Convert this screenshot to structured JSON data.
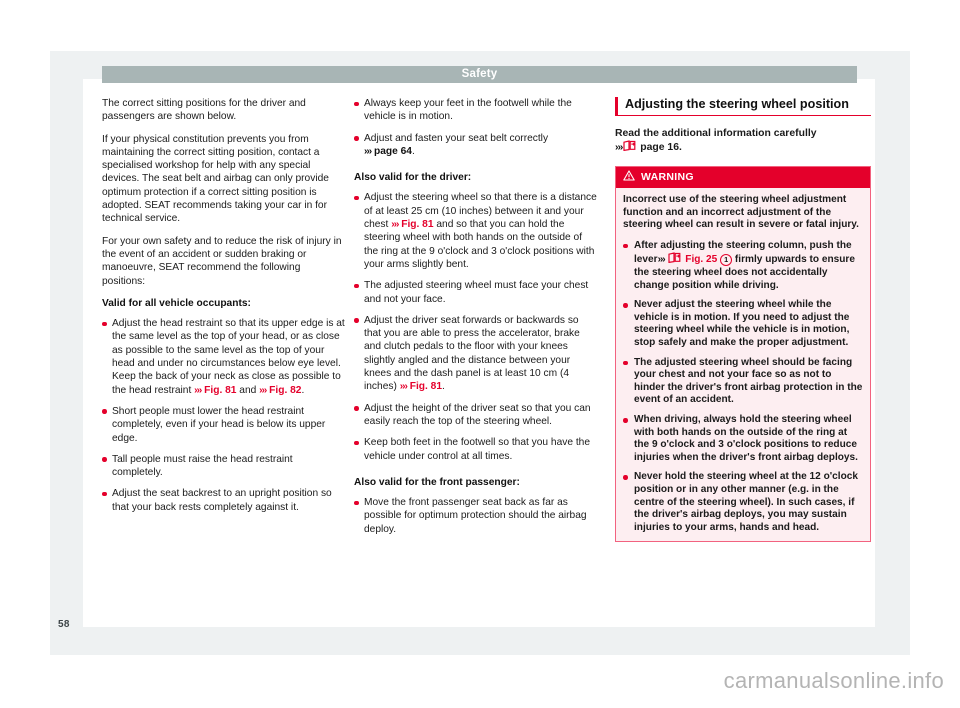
{
  "header": {
    "title": "Safety"
  },
  "folio": {
    "page_number": "58"
  },
  "watermark": {
    "text": "carmanualsonline.info"
  },
  "column1": {
    "p1": "The correct sitting positions for the driver and passengers are shown below.",
    "p2": "If your physical constitution prevents you from maintaining the correct sitting position, contact a specialised workshop for help with any special devices. The seat belt and airbag can only provide optimum protection if a correct sitting position is adopted. SEAT recommends taking your car in for technical service.",
    "p3": "For your own safety and to reduce the risk of injury in the event of an accident or sudden braking or manoeuvre, SEAT recommend the following positions:",
    "subhead": "Valid for all vehicle occupants:",
    "b1_a": "Adjust the head restraint so that its upper edge is at the same level as the top of your head, or as close as possible to the same level as the top of your head and under no circumstances below eye level. Keep the back of your neck as close as possible to the head restraint",
    "b1_ref1": "Fig. 81",
    "b1_mid": "and",
    "b1_ref2": "Fig. 82",
    "b1_end": ".",
    "b2": "Short people must lower the head restraint completely, even if your head is below its upper edge.",
    "b3": "Tall people must raise the head restraint completely.",
    "b4": "Adjust the seat backrest to an upright position so that your back rests completely against it."
  },
  "column2": {
    "b1": "Always keep your feet in the footwell while the vehicle is in motion.",
    "b2_a": "Adjust and fasten your seat belt correctly",
    "b2_ref": "page 64",
    "b2_end": ".",
    "subhead_driver": "Also valid for the driver:",
    "b3_a": "Adjust the steering wheel so that there is a distance of at least 25 cm (10 inches) between it and your chest",
    "b3_ref": "Fig. 81",
    "b3_b": "and so that you can hold the steering wheel with both hands on the outside of the ring at the 9 o'clock and 3 o'clock positions with your arms slightly bent.",
    "b4": "The adjusted steering wheel must face your chest and not your face.",
    "b5_a": "Adjust the driver seat forwards or backwards so that you are able to press the accelerator, brake and clutch pedals to the floor with your knees slightly angled and the distance between your knees and the dash panel is at least 10 cm (4 inches)",
    "b5_ref": "Fig. 81",
    "b5_end": ".",
    "b6": "Adjust the height of the driver seat so that you can easily reach the top of the steering wheel.",
    "b7": "Keep both feet in the footwell so that you have the vehicle under control at all times.",
    "subhead_passenger": "Also valid for the front passenger:",
    "b8": "Move the front passenger seat back as far as possible for optimum protection should the airbag deploy."
  },
  "column3": {
    "heading": "Adjusting the steering wheel position",
    "intro_line1": "Read the additional information carefully",
    "intro_page": "page 16",
    "intro_end": ".",
    "warning": {
      "label": "WARNING",
      "lead": "Incorrect use of the steering wheel adjustment function and an incorrect adjustment of the steering wheel can result in severe or fatal injury.",
      "b1_a": "After adjusting the steering column, push the lever",
      "b1_ref": "Fig. 25",
      "b1_circled": "1",
      "b1_b": "firmly upwards to ensure the steering wheel does not accidentally change position while driving.",
      "b2": "Never adjust the steering wheel while the vehicle is in motion. If you need to adjust the steering wheel while the vehicle is in motion, stop safely and make the proper adjustment.",
      "b3": "The adjusted steering wheel should be facing your chest and not your face so as not to hinder the driver's front airbag protection in the event of an accident.",
      "b4": "When driving, always hold the steering wheel with both hands on the outside of the ring at the 9 o'clock and 3 o'clock positions to reduce injuries when the driver's front airbag deploys.",
      "b5": "Never hold the steering wheel at the 12 o'clock position or in any other manner (e.g. in the centre of the steering wheel). In such cases, if the driver's airbag deploys, you may sustain injuries to your arms, hands and head."
    }
  },
  "icons": {
    "reference_arrows": "»›",
    "manual_book": "book-reference-icon",
    "warning_triangle": "warning-triangle-icon"
  },
  "colors": {
    "accent_red": "#e4002b",
    "header_gray": "#a8b5b5",
    "page_surround": "#eef1f2",
    "warning_bg": "#fdeef1",
    "warning_border": "#f2627f"
  }
}
